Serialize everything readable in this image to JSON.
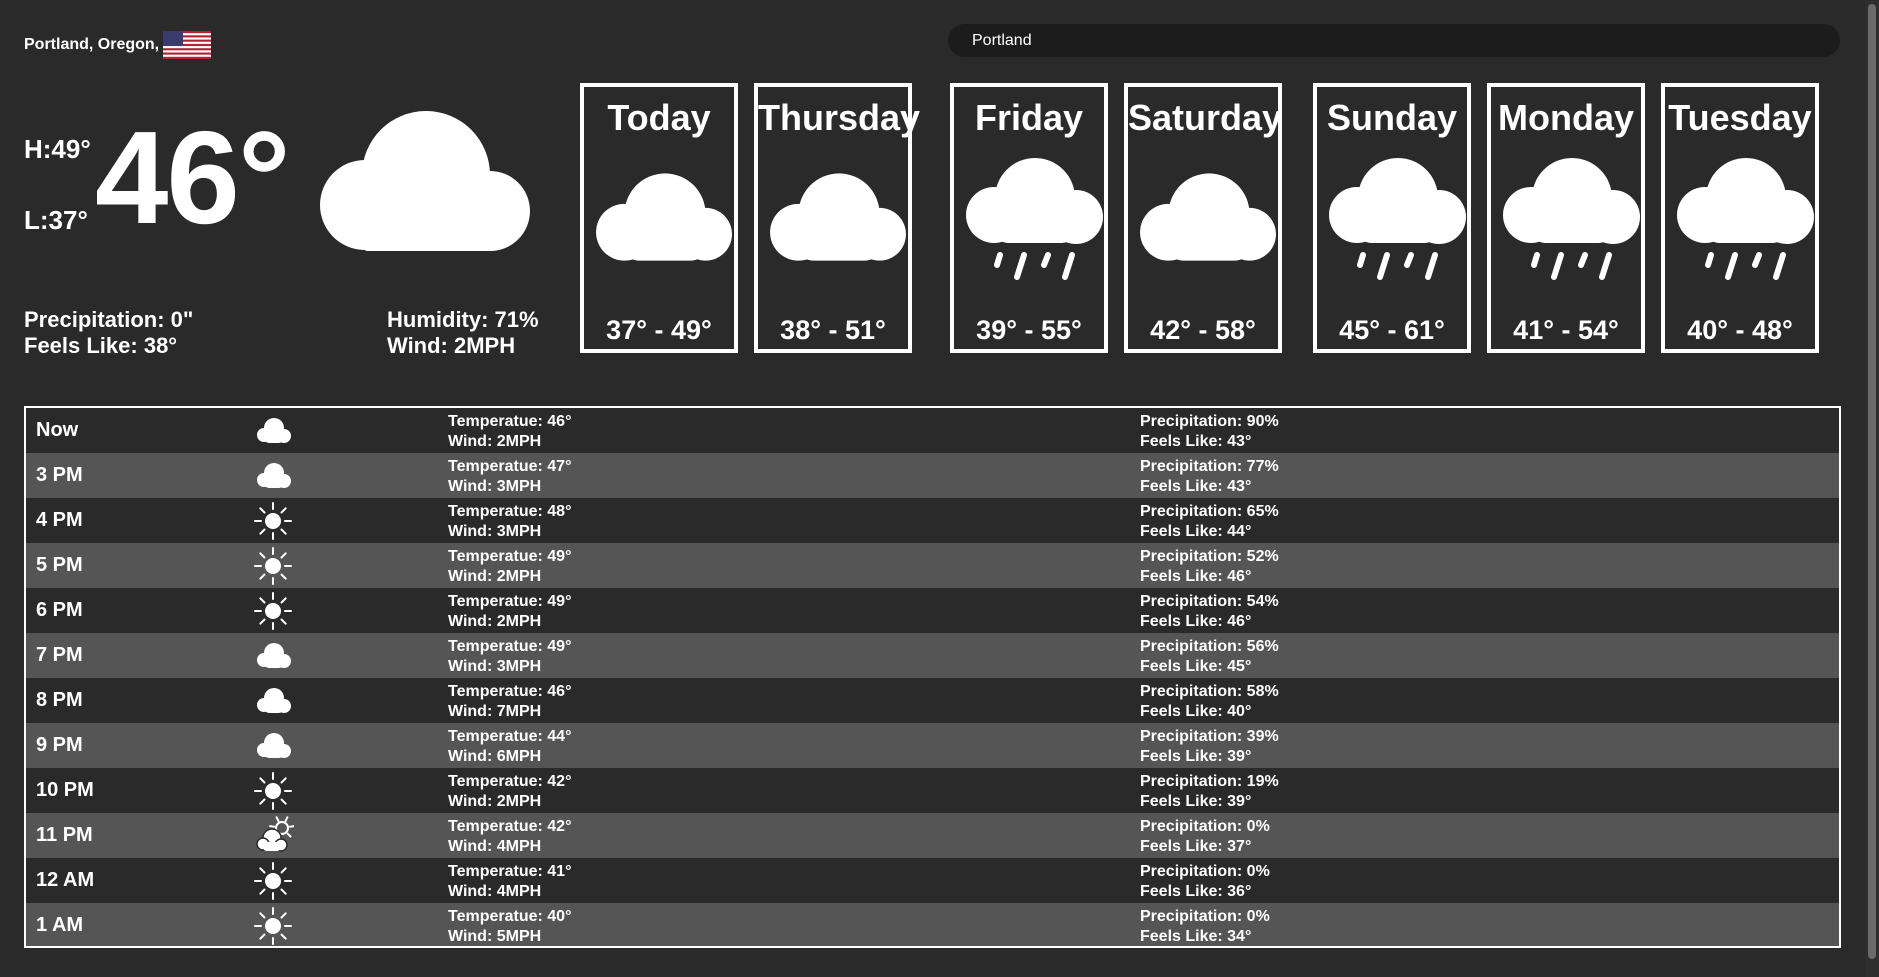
{
  "location": {
    "name": "Portland, Oregon,",
    "flag_icon": "us-flag-icon"
  },
  "search": {
    "value": "Portland",
    "placeholder": ""
  },
  "current": {
    "high": "H:49°",
    "low": "L:37°",
    "temp": "46°",
    "icon": "cloud-icon",
    "precipitation": "Precipitation: 0\"",
    "feels_like": "Feels Like: 38°",
    "humidity": "Humidity: 71%",
    "wind": "Wind: 2MPH"
  },
  "forecast": [
    {
      "day": "Today",
      "icon": "cloud-icon",
      "range": "37° - 49°"
    },
    {
      "day": "Thursday",
      "icon": "cloud-icon",
      "range": "38° - 51°"
    },
    {
      "day": "Friday",
      "icon": "rain-icon",
      "range": "39° - 55°"
    },
    {
      "day": "Saturday",
      "icon": "cloud-icon",
      "range": "42° - 58°"
    },
    {
      "day": "Sunday",
      "icon": "rain-icon",
      "range": "45° - 61°"
    },
    {
      "day": "Monday",
      "icon": "rain-icon",
      "range": "41° - 54°"
    },
    {
      "day": "Tuesday",
      "icon": "rain-icon",
      "range": "40° - 48°"
    }
  ],
  "hourly": [
    {
      "time": "Now",
      "icon": "cloud-icon",
      "temp": "Temperatue: 46°",
      "wind": "Wind: 2MPH",
      "precip": "Precipitation: 90%",
      "feels": "Feels Like: 43°"
    },
    {
      "time": "3 PM",
      "icon": "cloud-icon",
      "temp": "Temperatue: 47°",
      "wind": "Wind: 3MPH",
      "precip": "Precipitation: 77%",
      "feels": "Feels Like: 43°"
    },
    {
      "time": "4 PM",
      "icon": "sun-icon",
      "temp": "Temperatue: 48°",
      "wind": "Wind: 3MPH",
      "precip": "Precipitation: 65%",
      "feels": "Feels Like: 44°"
    },
    {
      "time": "5 PM",
      "icon": "sun-icon",
      "temp": "Temperatue: 49°",
      "wind": "Wind: 2MPH",
      "precip": "Precipitation: 52%",
      "feels": "Feels Like: 46°"
    },
    {
      "time": "6 PM",
      "icon": "sun-icon",
      "temp": "Temperatue: 49°",
      "wind": "Wind: 2MPH",
      "precip": "Precipitation: 54%",
      "feels": "Feels Like: 46°"
    },
    {
      "time": "7 PM",
      "icon": "cloud-icon",
      "temp": "Temperatue: 49°",
      "wind": "Wind: 3MPH",
      "precip": "Precipitation: 56%",
      "feels": "Feels Like: 45°"
    },
    {
      "time": "8 PM",
      "icon": "cloud-icon",
      "temp": "Temperatue: 46°",
      "wind": "Wind: 7MPH",
      "precip": "Precipitation: 58%",
      "feels": "Feels Like: 40°"
    },
    {
      "time": "9 PM",
      "icon": "cloud-icon",
      "temp": "Temperatue: 44°",
      "wind": "Wind: 6MPH",
      "precip": "Precipitation: 39%",
      "feels": "Feels Like: 39°"
    },
    {
      "time": "10 PM",
      "icon": "sun-icon",
      "temp": "Temperatue: 42°",
      "wind": "Wind: 2MPH",
      "precip": "Precipitation: 19%",
      "feels": "Feels Like: 39°"
    },
    {
      "time": "11 PM",
      "icon": "partly-cloudy-icon",
      "temp": "Temperatue: 42°",
      "wind": "Wind: 4MPH",
      "precip": "Precipitation: 0%",
      "feels": "Feels Like: 37°"
    },
    {
      "time": "12 AM",
      "icon": "sun-icon",
      "temp": "Temperatue: 41°",
      "wind": "Wind: 4MPH",
      "precip": "Precipitation: 0%",
      "feels": "Feels Like: 36°"
    },
    {
      "time": "1 AM",
      "icon": "sun-icon",
      "temp": "Temperatue: 40°",
      "wind": "Wind: 5MPH",
      "precip": "Precipitation: 0%",
      "feels": "Feels Like: 34°"
    }
  ],
  "colors": {
    "background": "#2a2a2a",
    "row_alt": "#555555",
    "search_bg": "#1c1c1c",
    "text": "#ffffff"
  }
}
